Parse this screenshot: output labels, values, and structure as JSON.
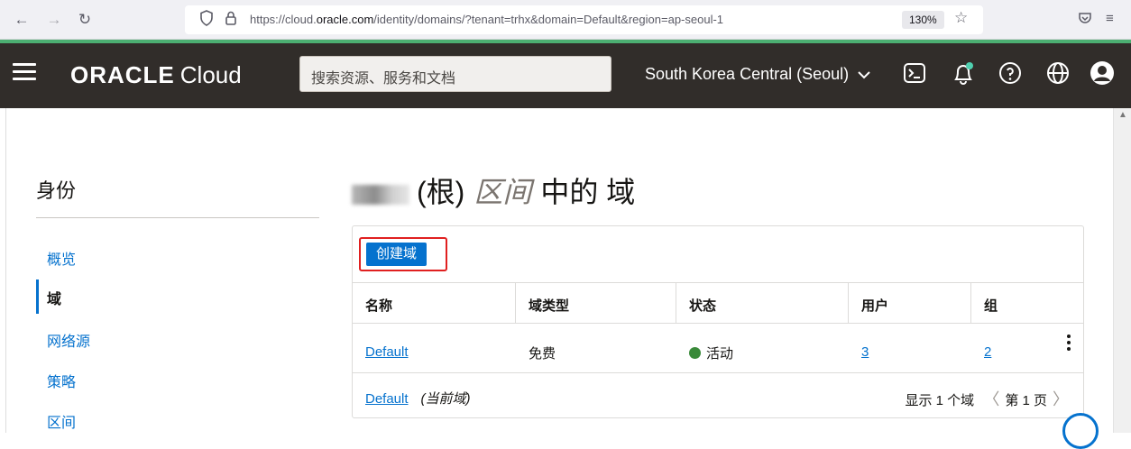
{
  "browser": {
    "url_prefix": "https://cloud.",
    "url_domain": "oracle.com",
    "url_suffix": "/identity/domains/?tenant=trhx&domain=Default&region=ap-seoul-1",
    "zoom": "130%"
  },
  "header": {
    "logo_brand": "ORACLE",
    "logo_product": "Cloud",
    "search_placeholder": "搜索资源、服务和文档",
    "region": "South Korea Central (Seoul)"
  },
  "sidebar": {
    "title": "身份",
    "items": [
      {
        "label": "概览",
        "active": false
      },
      {
        "label": "域",
        "active": true
      },
      {
        "label": "网络源",
        "active": false
      },
      {
        "label": "策略",
        "active": false
      },
      {
        "label": "区间",
        "active": false
      }
    ]
  },
  "main": {
    "title_part1": "(根)",
    "title_part2": "区间",
    "title_part3": "中的 域",
    "create_button": "创建域",
    "columns": [
      "名称",
      "域类型",
      "状态",
      "用户",
      "组"
    ],
    "rows": [
      {
        "name": "Default",
        "type": "免费",
        "status": "活动",
        "users": "3",
        "groups": "2"
      }
    ],
    "footer": {
      "domain_link": "Default",
      "current_note": "(当前域)",
      "count_text": "显示 1 个域",
      "page_text": "第 1 页"
    }
  },
  "colors": {
    "accent": "#0572ce",
    "header_bg": "#312d2a",
    "status_active": "#3a8a3a",
    "highlight": "#e02020"
  }
}
